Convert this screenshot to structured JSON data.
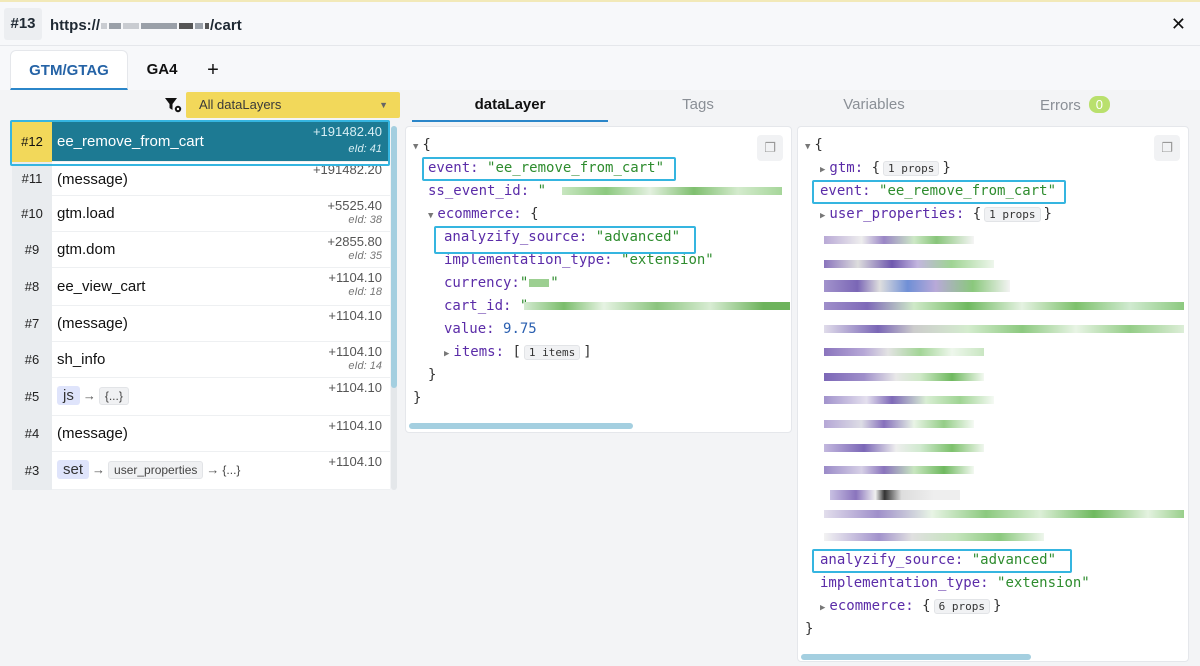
{
  "window": {
    "tab_number": "#13",
    "url_prefix": "https://",
    "url_suffix": "/cart"
  },
  "tabs": [
    {
      "label": "GTM/GTAG",
      "active": true
    },
    {
      "label": "GA4",
      "active": false
    }
  ],
  "add_tab_label": "+",
  "close_label": "✕",
  "filter": {
    "selected": "All dataLayers"
  },
  "events": [
    {
      "num": "#12",
      "name": "ee_remove_from_cart",
      "time": "+191482.40",
      "eid": "eId: 41",
      "selected": true
    },
    {
      "num": "#11",
      "name": "(message)",
      "time": "+191482.20",
      "eid": ""
    },
    {
      "num": "#10",
      "name": "gtm.load",
      "time": "+5525.40",
      "eid": "eId: 38"
    },
    {
      "num": "#9",
      "name": "gtm.dom",
      "time": "+2855.80",
      "eid": "eId: 35"
    },
    {
      "num": "#8",
      "name": "ee_view_cart",
      "time": "+1104.10",
      "eid": "eId: 18"
    },
    {
      "num": "#7",
      "name": "(message)",
      "time": "+1104.10",
      "eid": ""
    },
    {
      "num": "#6",
      "name": "sh_info",
      "time": "+1104.10",
      "eid": "eId: 14"
    },
    {
      "num": "#5",
      "cmd": "js",
      "arg": "{...}",
      "time": "+1104.10",
      "eid": ""
    },
    {
      "num": "#4",
      "name": "(message)",
      "time": "+1104.10",
      "eid": ""
    },
    {
      "num": "#3",
      "cmd": "set",
      "arg1": "user_properties",
      "arg": "{...}",
      "time": "+1104.10",
      "eid": ""
    }
  ],
  "right_tabs": [
    {
      "label": "dataLayer",
      "active": true
    },
    {
      "label": "Tags",
      "active": false
    },
    {
      "label": "Variables",
      "active": false
    },
    {
      "label": "Errors",
      "active": false,
      "badge": "0"
    }
  ],
  "datalayer_panel": {
    "event_key": "event:",
    "event_val": "\"ee_remove_from_cart\"",
    "ss_key": "ss_event_id:",
    "ss_val": "\"",
    "ecommerce_key": "ecommerce:",
    "analyzify_key": "analyzify_source:",
    "analyzify_val": "\"advanced\"",
    "impl_key": "implementation_type:",
    "impl_val": "\"extension\"",
    "currency_key": "currency:",
    "currency_val": "\"",
    "cart_key": "cart_id:",
    "cart_val": "\"",
    "value_key": "value:",
    "value_val": "9.75",
    "items_key": "items:",
    "items_chip": "1 items"
  },
  "variables_panel": {
    "gtm_key": "gtm:",
    "gtm_chip": "1 props",
    "event_key": "event:",
    "event_val": "\"ee_remove_from_cart\"",
    "user_props_key": "user_properties:",
    "user_props_chip": "1 props",
    "analyzify_key": "analyzify_source:",
    "analyzify_val": "\"advanced\"",
    "impl_key": "implementation_type:",
    "impl_val": "\"extension\"",
    "ecommerce_key": "ecommerce:",
    "ecommerce_chip": "6 props"
  },
  "colors": {
    "selected_row": "#1d7a93",
    "accent_yellow": "#f2d85a",
    "highlight_outline": "#35b5e0",
    "tab_active": "#2b86c9"
  }
}
